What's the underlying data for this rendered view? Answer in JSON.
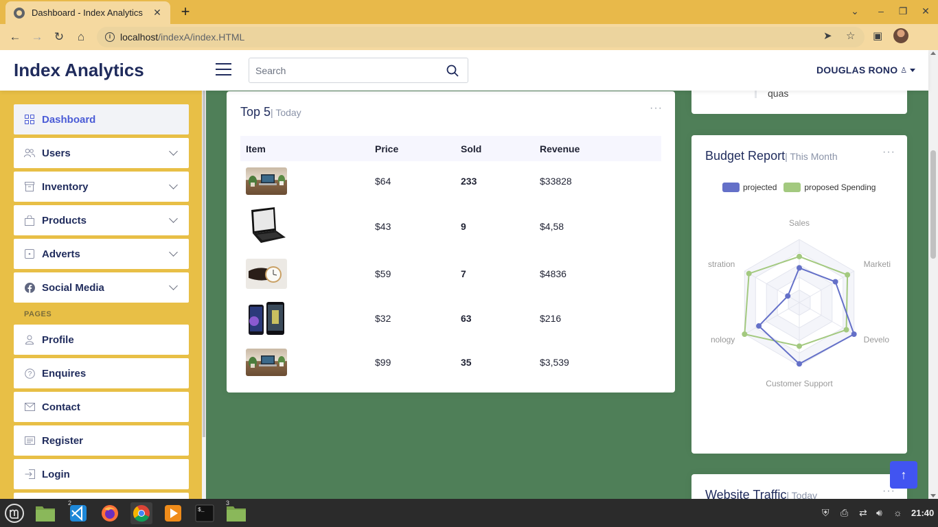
{
  "browser": {
    "tab_title": "Dashboard - Index Analytics",
    "tab_close": "✕",
    "new_tab": "+",
    "url_host": "localhost",
    "url_path": "/indexA/index.HTML"
  },
  "header": {
    "logo": "Index Analytics",
    "search_placeholder": "Search",
    "user_name": "DOUGLAS RONO"
  },
  "sidebar": {
    "items": [
      {
        "label": "Dashboard",
        "icon": "grid-icon"
      },
      {
        "label": "Users",
        "icon": "users-icon"
      },
      {
        "label": "Inventory",
        "icon": "archive-icon"
      },
      {
        "label": "Products",
        "icon": "bag-icon"
      },
      {
        "label": "Adverts",
        "icon": "square-dot-icon"
      },
      {
        "label": "Social Media",
        "icon": "facebook-icon"
      }
    ],
    "pages_heading": "PAGES",
    "pages": [
      {
        "label": "Profile",
        "icon": "person-icon"
      },
      {
        "label": "Enquires",
        "icon": "question-icon"
      },
      {
        "label": "Contact",
        "icon": "envelope-icon"
      },
      {
        "label": "Register",
        "icon": "card-list-icon"
      },
      {
        "label": "Login",
        "icon": "login-icon"
      }
    ]
  },
  "activity": {
    "text": "quas"
  },
  "top5": {
    "title": "Top 5",
    "subtitle": "| Today",
    "more": "···",
    "columns": [
      "Item",
      "Price",
      "Sold",
      "Revenue"
    ],
    "rows": [
      {
        "image": "desk-laptop-plants",
        "price": "$64",
        "sold": "233",
        "revenue": "$33828"
      },
      {
        "image": "black-laptop",
        "price": "$43",
        "sold": "9",
        "revenue": "$4,58"
      },
      {
        "image": "wrist-watch",
        "price": "$59",
        "sold": "7",
        "revenue": "$4836"
      },
      {
        "image": "smartphones",
        "price": "$32",
        "sold": "63",
        "revenue": "$216"
      },
      {
        "image": "desk-laptop-plants",
        "price": "$99",
        "sold": "35",
        "revenue": "$3,539"
      }
    ]
  },
  "budget": {
    "title": "Budget Report",
    "subtitle": "| This Month",
    "more": "···",
    "legend": [
      {
        "name": "projected",
        "color": "#6470c8"
      },
      {
        "name": "proposed Spending",
        "color": "#a3c97f"
      }
    ],
    "axis_labels": [
      "Sales",
      "Marketing",
      "Development",
      "Customer Support",
      "Information Technology",
      "Administration"
    ],
    "axis_labels_visible": [
      "Sales",
      "Marketi",
      "Develo",
      "Customer Support",
      "nology",
      "stration"
    ]
  },
  "chart_data": {
    "type": "radar",
    "categories": [
      "Sales",
      "Marketing",
      "Development",
      "Customer Support",
      "Information Technology",
      "Administration"
    ],
    "series": [
      {
        "name": "projected",
        "values": [
          0.55,
          0.66,
          1.0,
          0.97,
          0.74,
          0.21
        ],
        "color": "#6470c8"
      },
      {
        "name": "proposed Spending",
        "values": [
          0.73,
          0.88,
          0.86,
          0.69,
          1.0,
          0.92
        ],
        "color": "#a3c97f"
      }
    ],
    "rings": 5
  },
  "traffic": {
    "title": "Website Traffic",
    "subtitle": "| Today",
    "more": "···"
  },
  "taskbar": {
    "clock": "21:40",
    "badge_vscode": "2",
    "badge_files": "3"
  }
}
